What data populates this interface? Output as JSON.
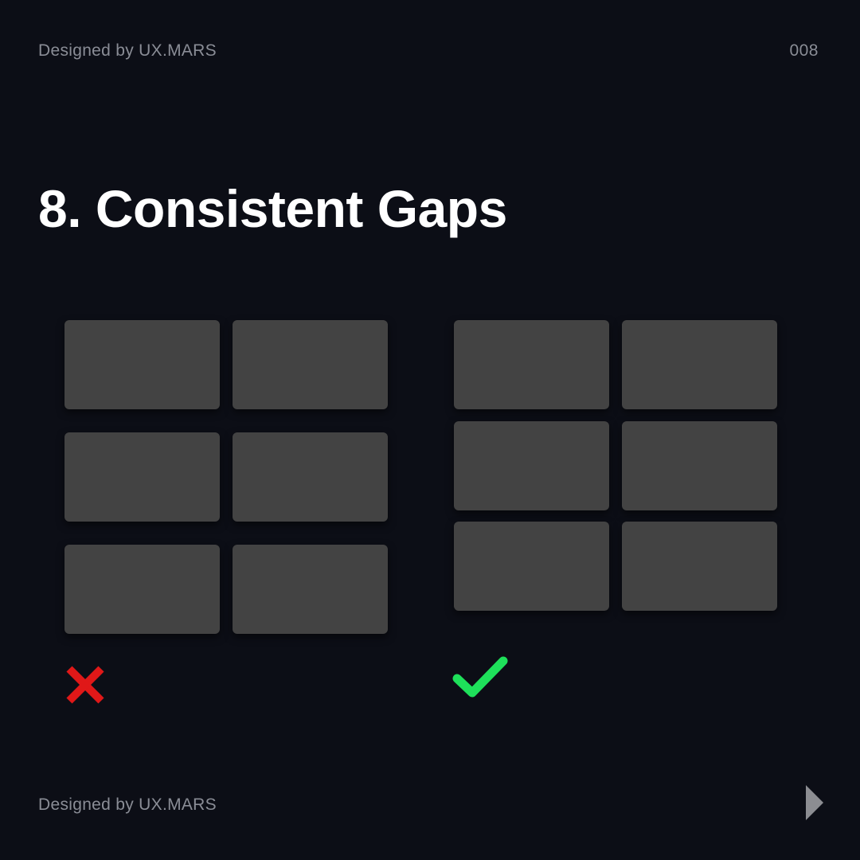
{
  "header": {
    "credit": "Designed by UX.MARS",
    "page_number": "008"
  },
  "title": "8. Consistent Gaps",
  "examples": {
    "bad": {
      "rows": 3,
      "columns": 2,
      "mark_icon": "cross-icon",
      "mark_color": "#e01818"
    },
    "good": {
      "rows": 3,
      "columns": 2,
      "mark_icon": "check-icon",
      "mark_color": "#1ee05a"
    }
  },
  "colors": {
    "background": "#0c0e16",
    "box": "#434343",
    "text_muted": "#8a8d96",
    "title": "#ffffff",
    "arrow": "#8c8d92"
  },
  "footer": {
    "credit": "Designed by UX.MARS",
    "next_icon": "next-arrow-icon"
  }
}
